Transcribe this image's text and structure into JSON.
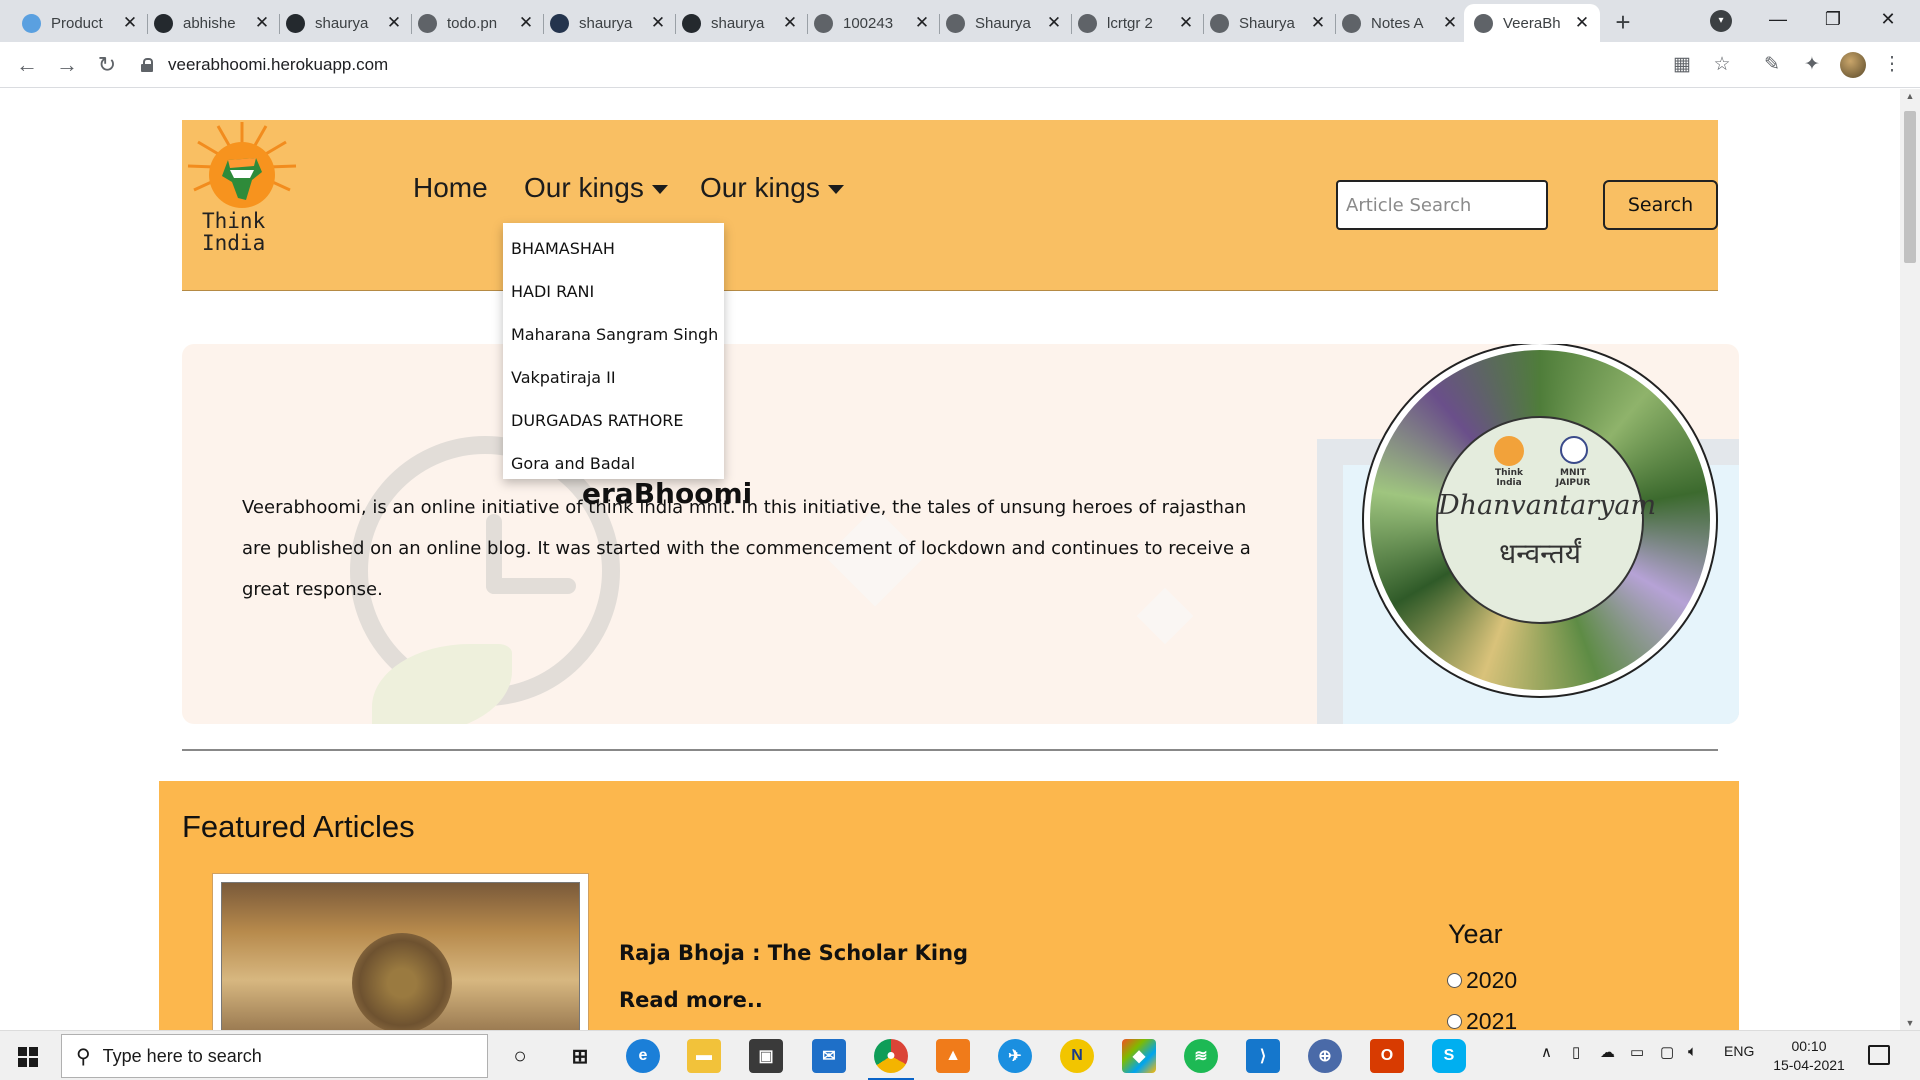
{
  "browser": {
    "tabs": [
      {
        "title": "Product",
        "favicon_color": "#5aa0e0"
      },
      {
        "title": "abhishe",
        "favicon_color": "#24292e"
      },
      {
        "title": "shaurya",
        "favicon_color": "#24292e"
      },
      {
        "title": "todo.pn",
        "favicon_color": "#5f6368"
      },
      {
        "title": "shaurya",
        "favicon_color": "#24344d"
      },
      {
        "title": "shaurya",
        "favicon_color": "#24292e"
      },
      {
        "title": "100243",
        "favicon_color": "#5f6368"
      },
      {
        "title": "Shaurya",
        "favicon_color": "#5f6368"
      },
      {
        "title": "lcrtgr 2",
        "favicon_color": "#5f6368"
      },
      {
        "title": "Shaurya",
        "favicon_color": "#5f6368"
      },
      {
        "title": "Notes A",
        "favicon_color": "#5f6368"
      },
      {
        "title": "VeeraBh",
        "favicon_color": "#5f6368",
        "active": true
      }
    ],
    "url": "veerabhoomi.herokuapp.com"
  },
  "site": {
    "logo_line1": "Think",
    "logo_line2": "India",
    "nav": {
      "home": "Home",
      "kings_1": "Our kings",
      "kings_2": "Our kings"
    },
    "search": {
      "placeholder": "Article Search",
      "button": "Search"
    },
    "dropdown_items": [
      "BHAMASHAH",
      "HADI RANI",
      "Maharana Sangram Singh",
      "Vakpatiraja II",
      "DURGADAS RATHORE",
      "Gora and Badal"
    ]
  },
  "hero": {
    "title": "eraBhoomi",
    "text": "Veerabhoomi, is an online initiative of think india mnit. In this initiative, the tales of unsung heroes of rajasthan are published on an online blog. It was started with the commencement of lockdown and continues to receive a great response.",
    "emblem": {
      "label_left_1": "Think",
      "label_left_2": "India",
      "label_right_1": "MNIT",
      "label_right_2": "JAIPUR",
      "script": "Dhanvantaryam",
      "devanagari": "धन्वन्तर्यं"
    }
  },
  "featured": {
    "heading": "Featured Articles",
    "article_title": "Raja Bhoja : The Scholar King",
    "read_more": "Read more..",
    "year_heading": "Year",
    "years": [
      "2020",
      "2021"
    ]
  },
  "taskbar": {
    "search_placeholder": "Type here to search",
    "language": "ENG",
    "time": "00:10",
    "date": "15-04-2021"
  },
  "colors": {
    "header_bg": "#f9bf63",
    "featured_bg": "#fcb74d",
    "hero_bg": "#fdf3ec"
  }
}
